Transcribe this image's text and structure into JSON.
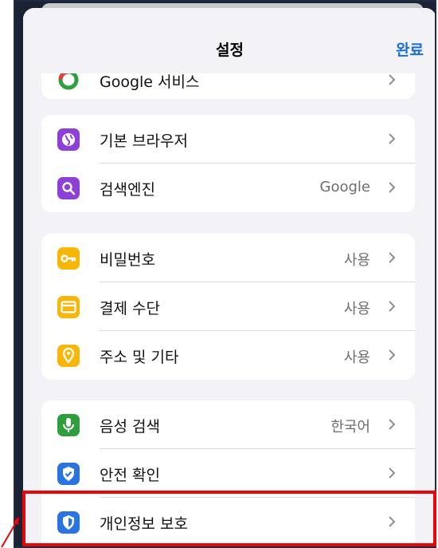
{
  "nav": {
    "title": "설정",
    "done_label": "완료"
  },
  "colors": {
    "accent": "#1a6fd6",
    "purple": "#8e3fd6",
    "yellow": "#f8b708",
    "green": "#2f9e3c",
    "blue": "#2a73e0",
    "highlight": "#e8060b"
  },
  "groups": {
    "top_partial": {
      "label": "Google 서비스"
    },
    "browser": {
      "items": [
        {
          "label": "기본 브라우저",
          "value": "",
          "icon": "globe-icon"
        },
        {
          "label": "검색엔진",
          "value": "Google",
          "icon": "search-icon"
        }
      ]
    },
    "autofill": {
      "items": [
        {
          "label": "비밀번호",
          "value": "사용",
          "icon": "key-icon"
        },
        {
          "label": "결제 수단",
          "value": "사용",
          "icon": "card-icon"
        },
        {
          "label": "주소 및 기타",
          "value": "사용",
          "icon": "location-pin-icon"
        }
      ]
    },
    "more": {
      "items": [
        {
          "label": "음성 검색",
          "value": "한국어",
          "icon": "microphone-icon"
        },
        {
          "label": "안전 확인",
          "value": "",
          "icon": "shield-check-icon"
        },
        {
          "label": "개인정보 보호",
          "value": "",
          "icon": "shield-privacy-icon"
        }
      ]
    }
  }
}
